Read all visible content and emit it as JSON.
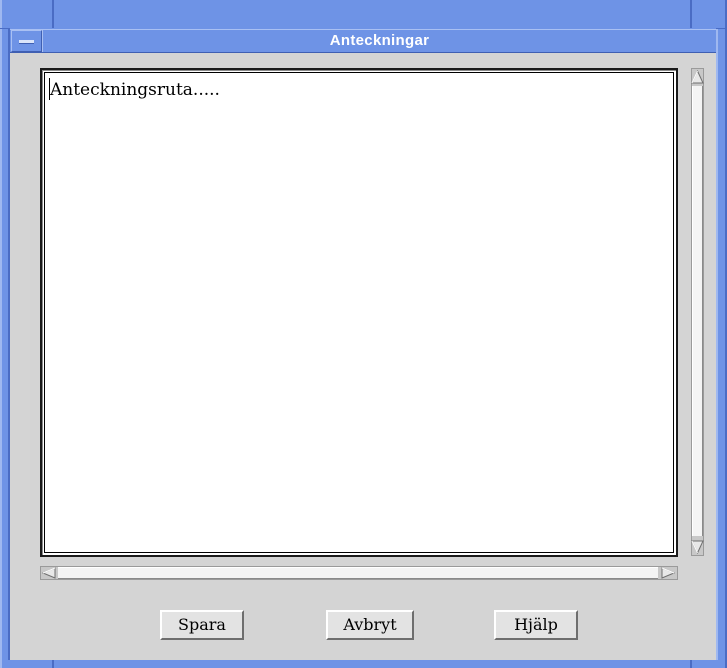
{
  "window": {
    "title": "Anteckningar",
    "menu_icon": "window-menu-icon",
    "frame_color": "#6e93e6"
  },
  "notes": {
    "text": "Anteckningsruta....."
  },
  "buttons": {
    "save": "Spara",
    "cancel": "Avbryt",
    "help": "Hjälp"
  },
  "scrollbars": {
    "up_icon": "up-arrow-icon",
    "down_icon": "down-arrow-icon",
    "left_icon": "left-arrow-icon",
    "right_icon": "right-arrow-icon"
  }
}
